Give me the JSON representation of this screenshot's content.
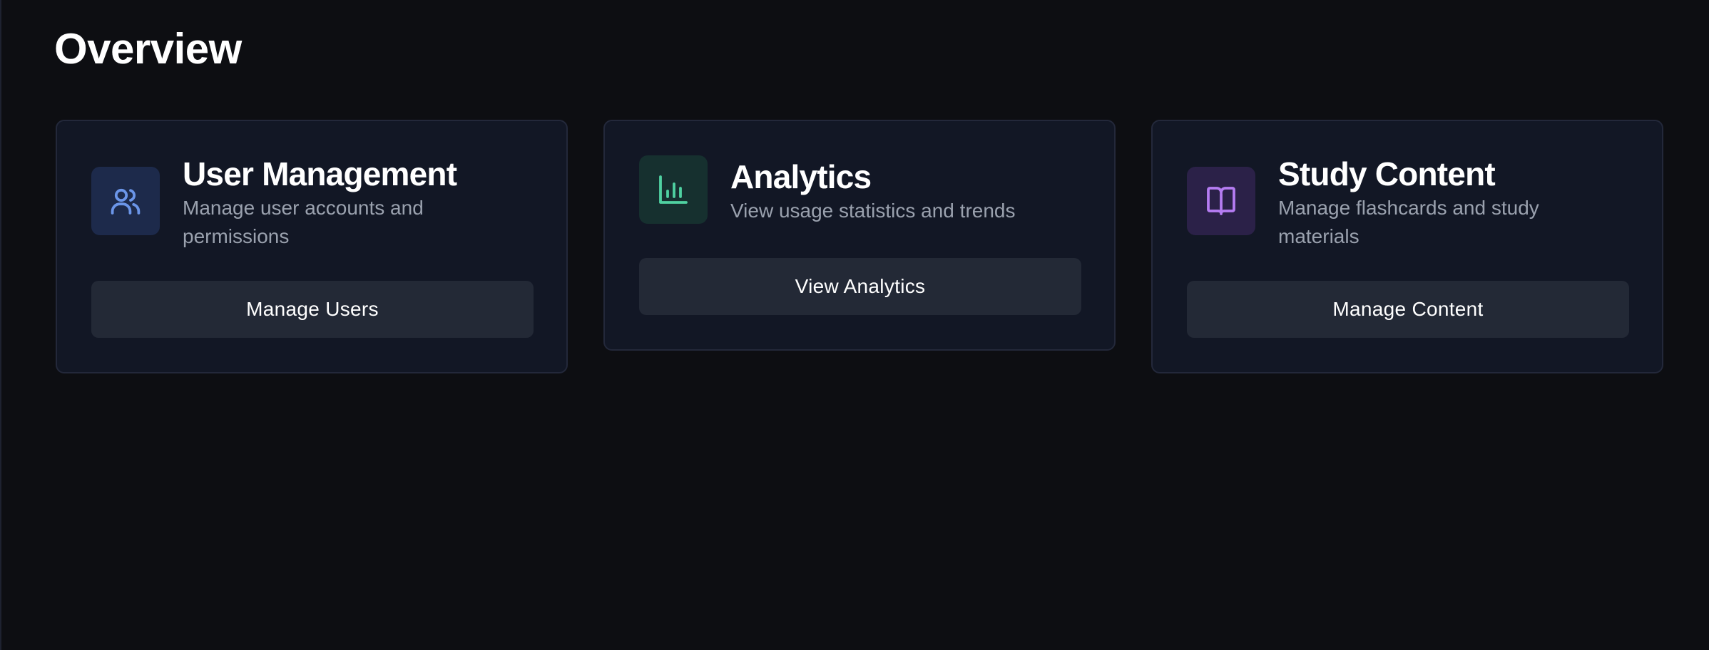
{
  "page": {
    "title": "Overview"
  },
  "cards": [
    {
      "title": "User Management",
      "description": "Manage user accounts and permissions",
      "button_label": "Manage Users",
      "icon": "users-icon",
      "accent": "#6b95e8",
      "tile_color": "#1d2a4b"
    },
    {
      "title": "Analytics",
      "description": "View usage statistics and trends",
      "button_label": "View Analytics",
      "icon": "bar-chart-icon",
      "accent": "#4fd1a1",
      "tile_color": "#16302f"
    },
    {
      "title": "Study Content",
      "description": "Manage flashcards and study materials",
      "button_label": "Manage Content",
      "icon": "book-open-icon",
      "accent": "#b57cf2",
      "tile_color": "#2b2148"
    }
  ]
}
